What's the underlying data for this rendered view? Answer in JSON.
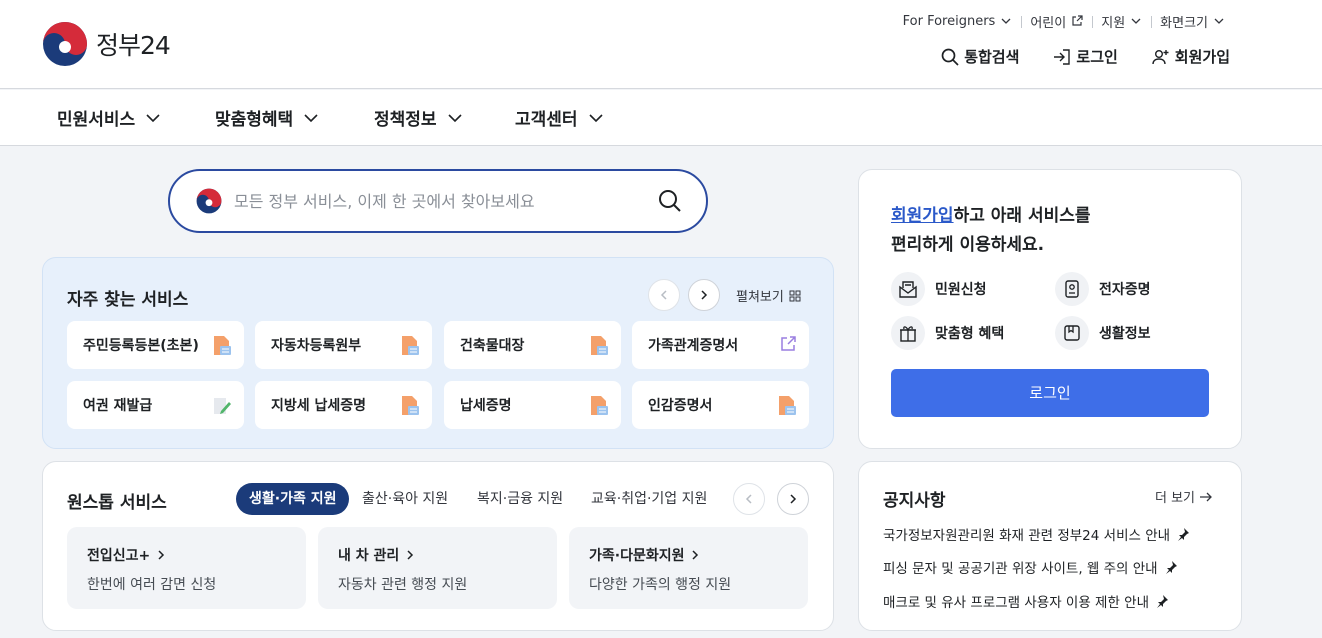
{
  "header": {
    "logo_text": "정부24",
    "utility": [
      {
        "label": "For Foreigners",
        "icon": "chevron-down-icon"
      },
      {
        "label": "어린이",
        "icon": "external-link-icon"
      },
      {
        "label": "지원",
        "icon": "chevron-down-icon"
      },
      {
        "label": "화면크기",
        "icon": "chevron-down-icon"
      }
    ],
    "search_label": "통합검색",
    "login_label": "로그인",
    "signup_label": "회원가입"
  },
  "gnb": [
    "민원서비스",
    "맞춤형혜택",
    "정책정보",
    "고객센터"
  ],
  "search": {
    "placeholder": "모든 정부 서비스, 이제 한 곳에서 찾아보세요"
  },
  "frequent": {
    "title": "자주 찾는 서비스",
    "expand_label": "펼쳐보기",
    "items": [
      {
        "label": "주민등록등본(초본)",
        "icon": "document-pdf-icon"
      },
      {
        "label": "자동차등록원부",
        "icon": "document-pdf-icon"
      },
      {
        "label": "건축물대장",
        "icon": "document-pdf-icon"
      },
      {
        "label": "가족관계증명서",
        "icon": "external-link-icon"
      },
      {
        "label": "여권 재발급",
        "icon": "edit-form-icon"
      },
      {
        "label": "지방세 납세증명",
        "icon": "document-pdf-icon"
      },
      {
        "label": "납세증명",
        "icon": "document-pdf-icon"
      },
      {
        "label": "인감증명서",
        "icon": "document-pdf-icon"
      }
    ]
  },
  "onestop": {
    "title": "원스톱 서비스",
    "tabs": [
      "생활·가족 지원",
      "출산·육아 지원",
      "복지·금융 지원",
      "교육·취업·기업 지원"
    ],
    "active_tab": "생활·가족 지원",
    "cards": [
      {
        "title": "전입신고+",
        "desc": "한번에 여러 감면 신청"
      },
      {
        "title": "내 차 관리",
        "desc": "자동차 관련 행정 지원"
      },
      {
        "title": "가족·다문화지원",
        "desc": "다양한 가족의 행정 지원"
      }
    ]
  },
  "login_box": {
    "signup_link": "회원가입",
    "message_rest": "하고 아래 서비스를",
    "message_line2": "편리하게 이용하세요.",
    "features": [
      {
        "label": "민원신청",
        "icon": "mail-document-icon"
      },
      {
        "label": "전자증명",
        "icon": "id-card-icon"
      },
      {
        "label": "맞춤형 혜택",
        "icon": "gift-icon"
      },
      {
        "label": "생활정보",
        "icon": "bookmark-icon"
      }
    ],
    "button_label": "로그인"
  },
  "notice": {
    "title": "공지사항",
    "more_label": "더 보기",
    "items": [
      "국가정보자원관리원 화재 관련 정부24 서비스 안내",
      "피싱 문자 및 공공기관 위장 사이트, 웹 주의 안내",
      "매크로 및 유사 프로그램 사용자 이용 제한 안내"
    ]
  },
  "colors": {
    "primary": "#1b3b7a",
    "accent": "#3e6ee8",
    "frequent_bg": "#e7f0fb"
  }
}
